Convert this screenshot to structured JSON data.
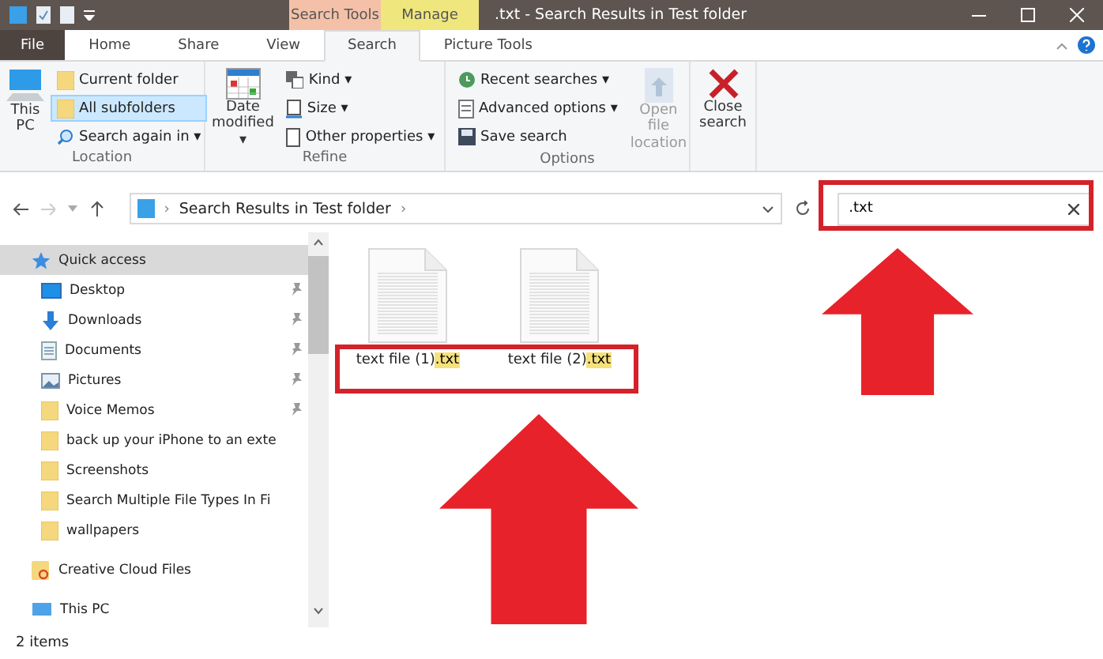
{
  "window": {
    "title": ".txt - Search Results in Test folder"
  },
  "context_tabs": [
    {
      "label": "Search Tools",
      "kind": "search"
    },
    {
      "label": "Manage",
      "kind": "manage"
    }
  ],
  "ribbon_tabs": [
    {
      "label": "File",
      "kind": "file",
      "selected": false
    },
    {
      "label": "Home",
      "kind": "plain",
      "selected": false
    },
    {
      "label": "Share",
      "kind": "plain",
      "selected": false
    },
    {
      "label": "View",
      "kind": "plain",
      "selected": false
    },
    {
      "label": "Search",
      "kind": "plain",
      "selected": true
    },
    {
      "label": "Picture Tools",
      "kind": "plain",
      "selected": false
    }
  ],
  "ribbon": {
    "location": {
      "label": "Location",
      "this_pc": "This PC",
      "current_folder": {
        "label": "Current folder",
        "selected": false
      },
      "all_subfolders": {
        "label": "All subfolders",
        "selected": true
      },
      "search_again": "Search again in ▾"
    },
    "refine": {
      "label": "Refine",
      "date_modified": "Date modified ▾",
      "kind": "Kind ▾",
      "size": "Size ▾",
      "other": "Other properties ▾"
    },
    "options": {
      "label": "Options",
      "recent": "Recent searches ▾",
      "advanced": "Advanced options ▾",
      "save": "Save search",
      "open_location": {
        "label": "Open file location",
        "disabled": true
      },
      "close": "Close search"
    }
  },
  "address": {
    "path": "Search Results in Test folder",
    "separators": [
      "›",
      "›"
    ]
  },
  "search": {
    "value": ".txt"
  },
  "nav": [
    {
      "label": "Quick access",
      "kind": "star",
      "selected": true,
      "children": [
        {
          "label": "Desktop",
          "kind": "desktop",
          "pinned": true
        },
        {
          "label": "Downloads",
          "kind": "download",
          "pinned": true
        },
        {
          "label": "Documents",
          "kind": "document",
          "pinned": true
        },
        {
          "label": "Pictures",
          "kind": "pictures",
          "pinned": true
        },
        {
          "label": "Voice Memos",
          "kind": "folder",
          "pinned": true
        },
        {
          "label": "back up your iPhone to an exte",
          "kind": "folder",
          "pinned": false
        },
        {
          "label": "Screenshots",
          "kind": "folder",
          "pinned": false
        },
        {
          "label": "Search Multiple File Types In Fi",
          "kind": "folder",
          "pinned": false
        },
        {
          "label": "wallpapers",
          "kind": "folder",
          "pinned": false
        }
      ]
    },
    {
      "label": "Creative Cloud Files",
      "kind": "cloud",
      "selected": false
    },
    {
      "label": "This PC",
      "kind": "pc",
      "selected": false
    }
  ],
  "files": [
    {
      "name": "text file (1)",
      "match": ".txt"
    },
    {
      "name": "text file (2)",
      "match": ".txt"
    }
  ],
  "status_bar": {
    "count": "2 items"
  }
}
